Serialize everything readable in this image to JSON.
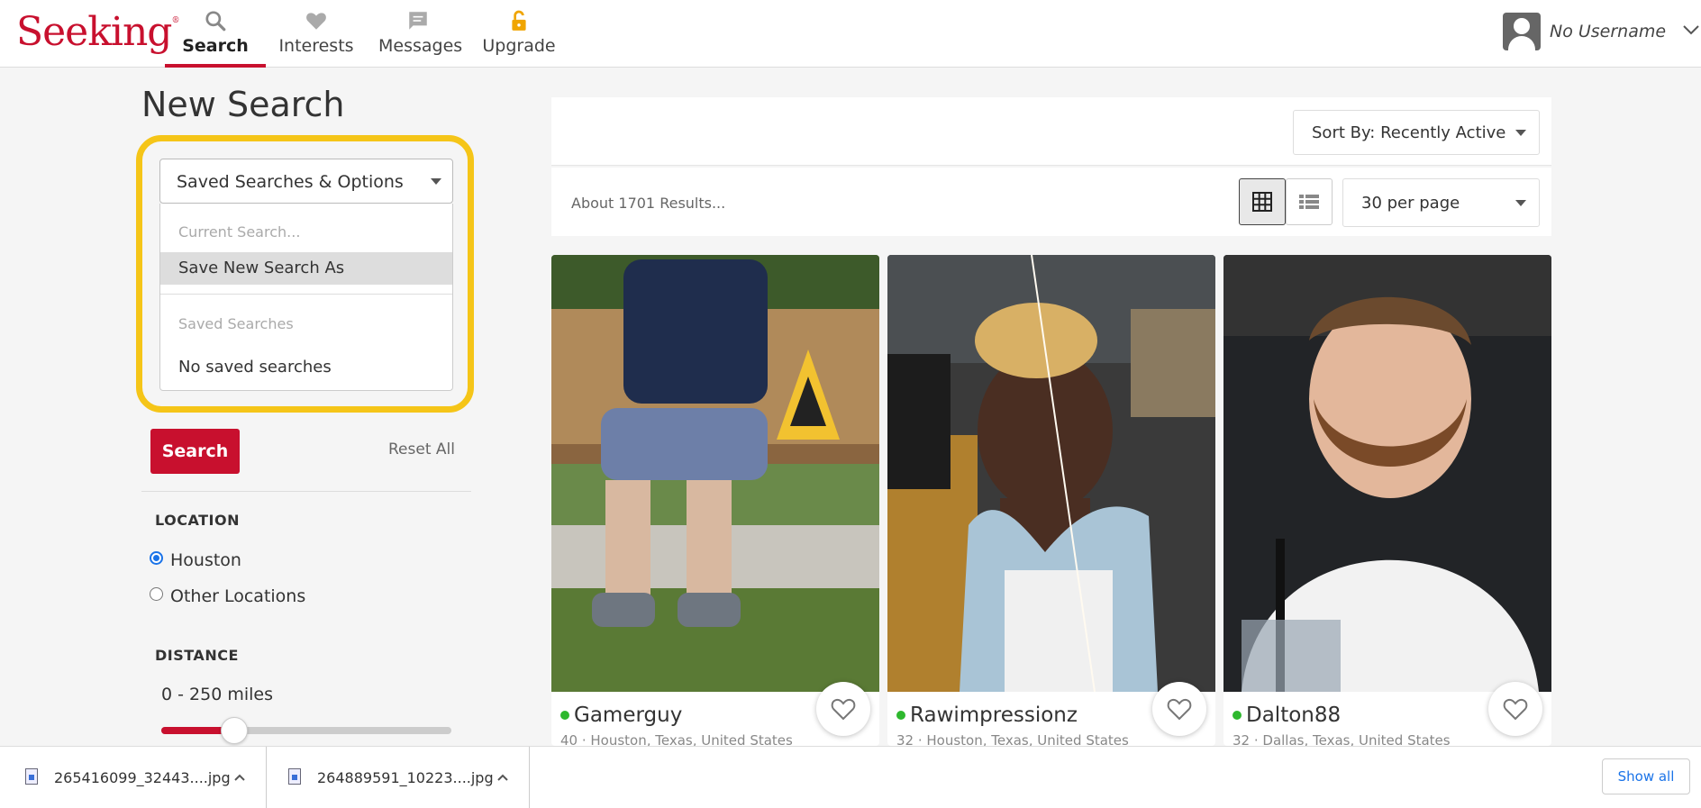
{
  "brand": {
    "logo_text": "Seeking",
    "logo_mark": "®",
    "color": "#c8102e"
  },
  "nav": {
    "items": [
      {
        "label": "Search",
        "icon": "search-icon",
        "active": true
      },
      {
        "label": "Interests",
        "icon": "heart-icon"
      },
      {
        "label": "Messages",
        "icon": "message-icon"
      },
      {
        "label": "Upgrade",
        "icon": "unlock-icon",
        "icon_color": "#f0a500"
      }
    ]
  },
  "user": {
    "name": "No Username"
  },
  "sidebar": {
    "title": "New Search",
    "saved_select": {
      "label": "Saved Searches & Options",
      "menu": {
        "current_header": "Current Search...",
        "save_item": "Save New Search As",
        "saved_header": "Saved Searches",
        "empty_text": "No saved searches"
      }
    },
    "search_button": "Search",
    "reset_link": "Reset All",
    "location": {
      "label": "LOCATION",
      "options": [
        {
          "label": "Houston",
          "checked": true
        },
        {
          "label": "Other Locations",
          "checked": false
        }
      ]
    },
    "distance": {
      "label": "DISTANCE",
      "value_text": "0 - 250 miles",
      "max_fraction": 0.22
    }
  },
  "results": {
    "sort_label": "Sort By: Recently Active",
    "count_text": "About 1701 Results...",
    "per_page": "30 per page",
    "profiles": [
      {
        "name": "Gamerguy",
        "meta": "40 · Houston, Texas, United States",
        "online": true
      },
      {
        "name": "Rawimpressionz",
        "meta": "32 · Houston, Texas, United States",
        "online": true
      },
      {
        "name": "Dalton88",
        "meta": "32 · Dallas, Texas, United States",
        "online": true
      }
    ]
  },
  "downloads": {
    "files": [
      {
        "name": "265416099_32443....jpg"
      },
      {
        "name": "264889591_10223....jpg"
      }
    ],
    "show_all": "Show all"
  }
}
